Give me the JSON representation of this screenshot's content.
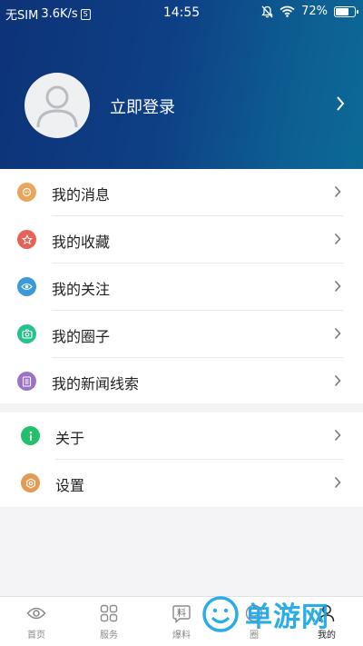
{
  "status_bar": {
    "carrier": "无SIM",
    "speed": "3.6K/s",
    "sim_icon_text": "S",
    "time": "14:55",
    "battery": "72%",
    "battery_level": 0.72
  },
  "profile": {
    "login_label": "立即登录"
  },
  "menu_primary": [
    {
      "label": "我的消息",
      "icon": "message-icon",
      "color": "#e9a55b"
    },
    {
      "label": "我的收藏",
      "icon": "star-icon",
      "color": "#e86156"
    },
    {
      "label": "我的关注",
      "icon": "eye-icon",
      "color": "#3b9ad8"
    },
    {
      "label": "我的圈子",
      "icon": "camera-icon",
      "color": "#27c08f"
    },
    {
      "label": "我的新闻线索",
      "icon": "document-icon",
      "color": "#9b73c6"
    }
  ],
  "menu_secondary": [
    {
      "label": "关于",
      "icon": "info-icon",
      "color": "#22c06a"
    },
    {
      "label": "设置",
      "icon": "settings-icon",
      "color": "#e39a52"
    }
  ],
  "tabbar": [
    {
      "label": "首页",
      "icon": "eye-tab-icon"
    },
    {
      "label": "服务",
      "icon": "grid-icon"
    },
    {
      "label": "爆料",
      "icon": "tipoff-icon",
      "glyph": "料"
    },
    {
      "label": "圈",
      "icon": "smile-icon"
    },
    {
      "label": "我的",
      "icon": "user-icon",
      "active": true
    }
  ],
  "watermark": {
    "text": "单游网"
  },
  "colors": {
    "header_start": "#0d3378",
    "header_end": "#0c6a97",
    "watermark": "#1aa6e8"
  }
}
